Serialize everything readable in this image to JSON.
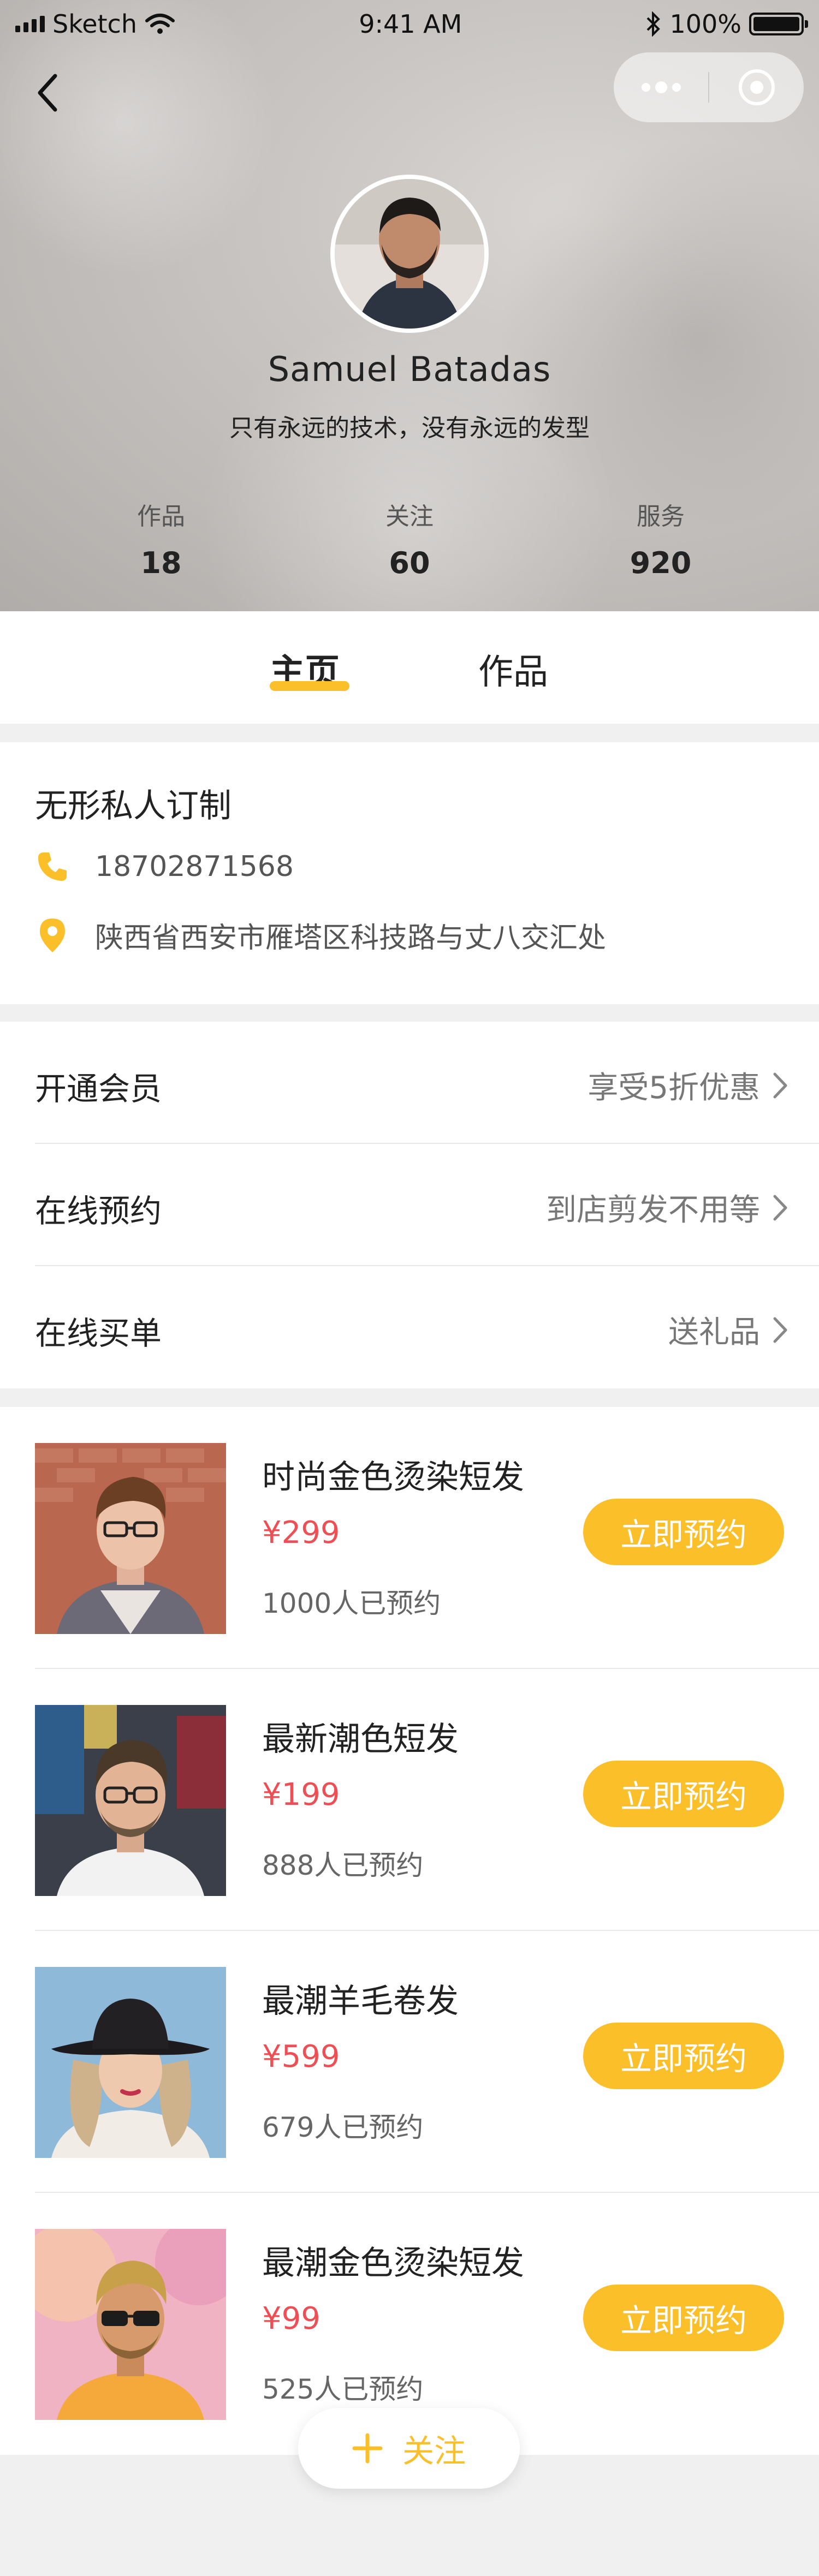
{
  "status_bar": {
    "carrier": "Sketch",
    "time": "9:41 AM",
    "battery": "100%"
  },
  "profile": {
    "name": "Samuel Batadas",
    "motto": "只有永远的技术，没有永远的发型",
    "stats": [
      {
        "label": "作品",
        "value": "18"
      },
      {
        "label": "关注",
        "value": "60"
      },
      {
        "label": "服务",
        "value": "920"
      }
    ]
  },
  "tabs": [
    {
      "label": "主页",
      "active": true
    },
    {
      "label": "作品",
      "active": false
    }
  ],
  "shop": {
    "name": "无形私人订制",
    "phone": "18702871568",
    "address": "陕西省西安市雁塔区科技路与丈八交汇处"
  },
  "menu": [
    {
      "title": "开通会员",
      "hint": "享受5折优惠"
    },
    {
      "title": "在线预约",
      "hint": "到店剪发不用等"
    },
    {
      "title": "在线买单",
      "hint": "送礼品"
    }
  ],
  "products": [
    {
      "title": "时尚金色烫染短发",
      "price": "¥299",
      "count": "1000人已预约",
      "button": "立即预约"
    },
    {
      "title": "最新潮色短发",
      "price": "¥199",
      "count": "888人已预约",
      "button": "立即预约"
    },
    {
      "title": "最潮羊毛卷发",
      "price": "¥599",
      "count": "679人已预约",
      "button": "立即预约"
    },
    {
      "title": "最潮金色烫染短发",
      "price": "¥99",
      "count": "525人已预约",
      "button": "立即预约"
    }
  ],
  "follow_button": {
    "label": "关注"
  },
  "colors": {
    "accent": "#fbbf2a",
    "price": "#f04e55",
    "divider": "#e8e8e8",
    "page_bg": "#f0f0f0"
  }
}
